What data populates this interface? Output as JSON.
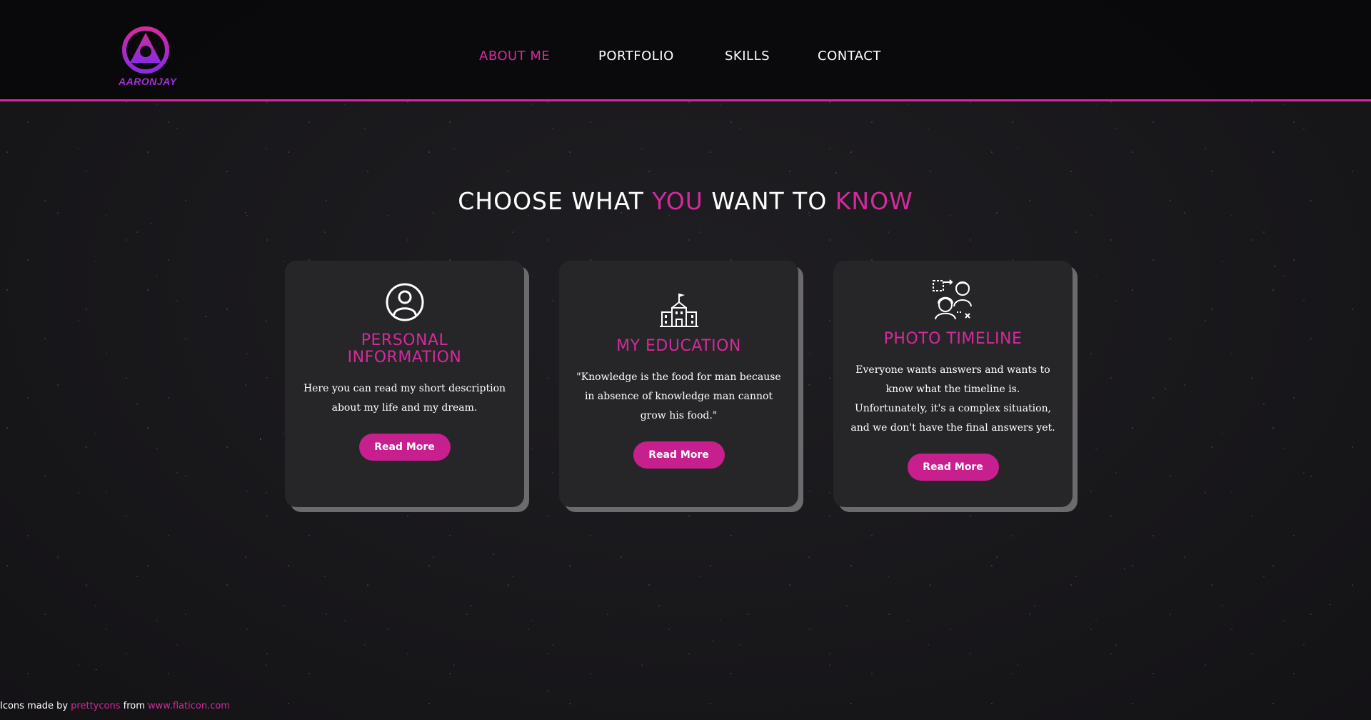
{
  "header": {
    "logo_text": "AARONJAY",
    "nav": [
      {
        "label": "ABOUT ME",
        "active": true
      },
      {
        "label": "PORTFOLIO",
        "active": false
      },
      {
        "label": "SKILLS",
        "active": false
      },
      {
        "label": "CONTACT",
        "active": false
      }
    ]
  },
  "main": {
    "heading": {
      "part1": "CHOOSE WHAT ",
      "accent1": "YOU",
      "part2": " WANT TO ",
      "accent2": "KNOW"
    },
    "cards": [
      {
        "icon": "user-circle-icon",
        "title": "PERSONAL INFORMATION",
        "text": "Here you can read my short description about my life and my dream.",
        "button": "Read More"
      },
      {
        "icon": "school-building-icon",
        "title": "MY EDUCATION",
        "text": "\"Knowledge is the food for man because in absence of knowledge man cannot grow his food.\"",
        "button": "Read More"
      },
      {
        "icon": "timeline-people-icon",
        "title": "PHOTO TIMELINE",
        "text": "Everyone wants answers and wants to know what the timeline is. Unfortunately, it's a complex situation, and we don't have the final answers yet.",
        "button": "Read More"
      }
    ]
  },
  "footer": {
    "credit_prefix": "Icons made by ",
    "credit_author": "prettycons",
    "credit_middle": " from ",
    "credit_site": "www.flaticon.com"
  },
  "colors": {
    "accent": "#d42a9c",
    "button": "#c71f8e",
    "card_bg": "#262628",
    "card_shadow": "#6b6b6d",
    "logo": "#a52fd6"
  }
}
